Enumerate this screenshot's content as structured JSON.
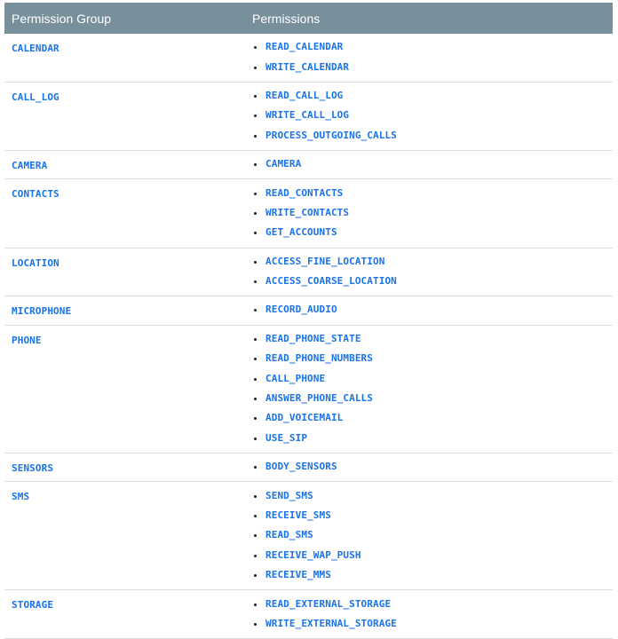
{
  "header": {
    "group_label": "Permission Group",
    "permissions_label": "Permissions"
  },
  "rows": [
    {
      "group": "CALENDAR",
      "permissions": [
        "READ_CALENDAR",
        "WRITE_CALENDAR"
      ]
    },
    {
      "group": "CALL_LOG",
      "permissions": [
        "READ_CALL_LOG",
        "WRITE_CALL_LOG",
        "PROCESS_OUTGOING_CALLS"
      ]
    },
    {
      "group": "CAMERA",
      "permissions": [
        "CAMERA"
      ]
    },
    {
      "group": "CONTACTS",
      "permissions": [
        "READ_CONTACTS",
        "WRITE_CONTACTS",
        "GET_ACCOUNTS"
      ]
    },
    {
      "group": "LOCATION",
      "permissions": [
        "ACCESS_FINE_LOCATION",
        "ACCESS_COARSE_LOCATION"
      ]
    },
    {
      "group": "MICROPHONE",
      "permissions": [
        "RECORD_AUDIO"
      ]
    },
    {
      "group": "PHONE",
      "permissions": [
        "READ_PHONE_STATE",
        "READ_PHONE_NUMBERS",
        "CALL_PHONE",
        "ANSWER_PHONE_CALLS",
        "ADD_VOICEMAIL",
        "USE_SIP"
      ]
    },
    {
      "group": "SENSORS",
      "permissions": [
        "BODY_SENSORS"
      ]
    },
    {
      "group": "SMS",
      "permissions": [
        "SEND_SMS",
        "RECEIVE_SMS",
        "READ_SMS",
        "RECEIVE_WAP_PUSH",
        "RECEIVE_MMS"
      ]
    },
    {
      "group": "STORAGE",
      "permissions": [
        "READ_EXTERNAL_STORAGE",
        "WRITE_EXTERNAL_STORAGE"
      ]
    }
  ]
}
